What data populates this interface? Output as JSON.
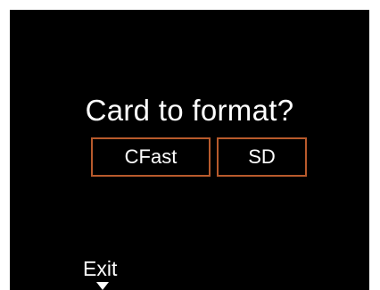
{
  "dialog": {
    "title": "Card to format?",
    "options": [
      {
        "label": "CFast"
      },
      {
        "label": "SD"
      }
    ],
    "exit_label": "Exit",
    "exit_icon": "down-arrow-icon"
  },
  "colors": {
    "background": "#000000",
    "text": "#ffffff",
    "option_border": "#b85a2c"
  }
}
